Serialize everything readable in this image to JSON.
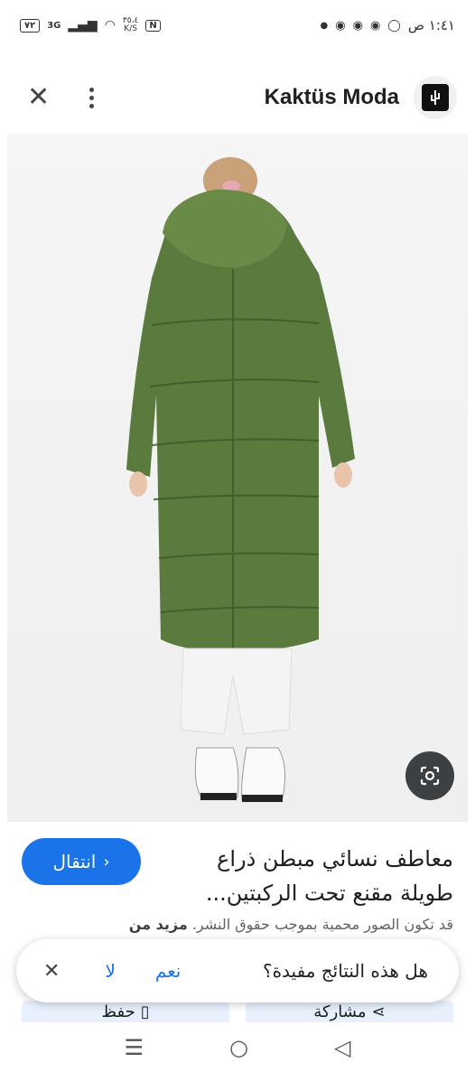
{
  "status_bar": {
    "time": "١:٤١ ص",
    "battery": "٧٢",
    "network": "3G",
    "speed_value": "٣٥،٤",
    "speed_unit": "K/S",
    "nfc": "N"
  },
  "header": {
    "brand_name": "Kaktüs Moda"
  },
  "product": {
    "title": "معاطف نسائي مبطن ذراع طويلة مقنع تحت الركبتين...",
    "visit_label": "انتقال",
    "copyright_text": "قد تكون الصور محمية بموجب حقوق النشر.",
    "more_label": "مزيد من"
  },
  "feedback": {
    "question": "هل هذه النتائج مفيدة؟",
    "yes": "نعم",
    "no": "لا"
  },
  "actions": {
    "share": "مشاركة",
    "save": "حفظ"
  },
  "colors": {
    "accent": "#1a73e8",
    "coat": "#5b7a3e"
  }
}
